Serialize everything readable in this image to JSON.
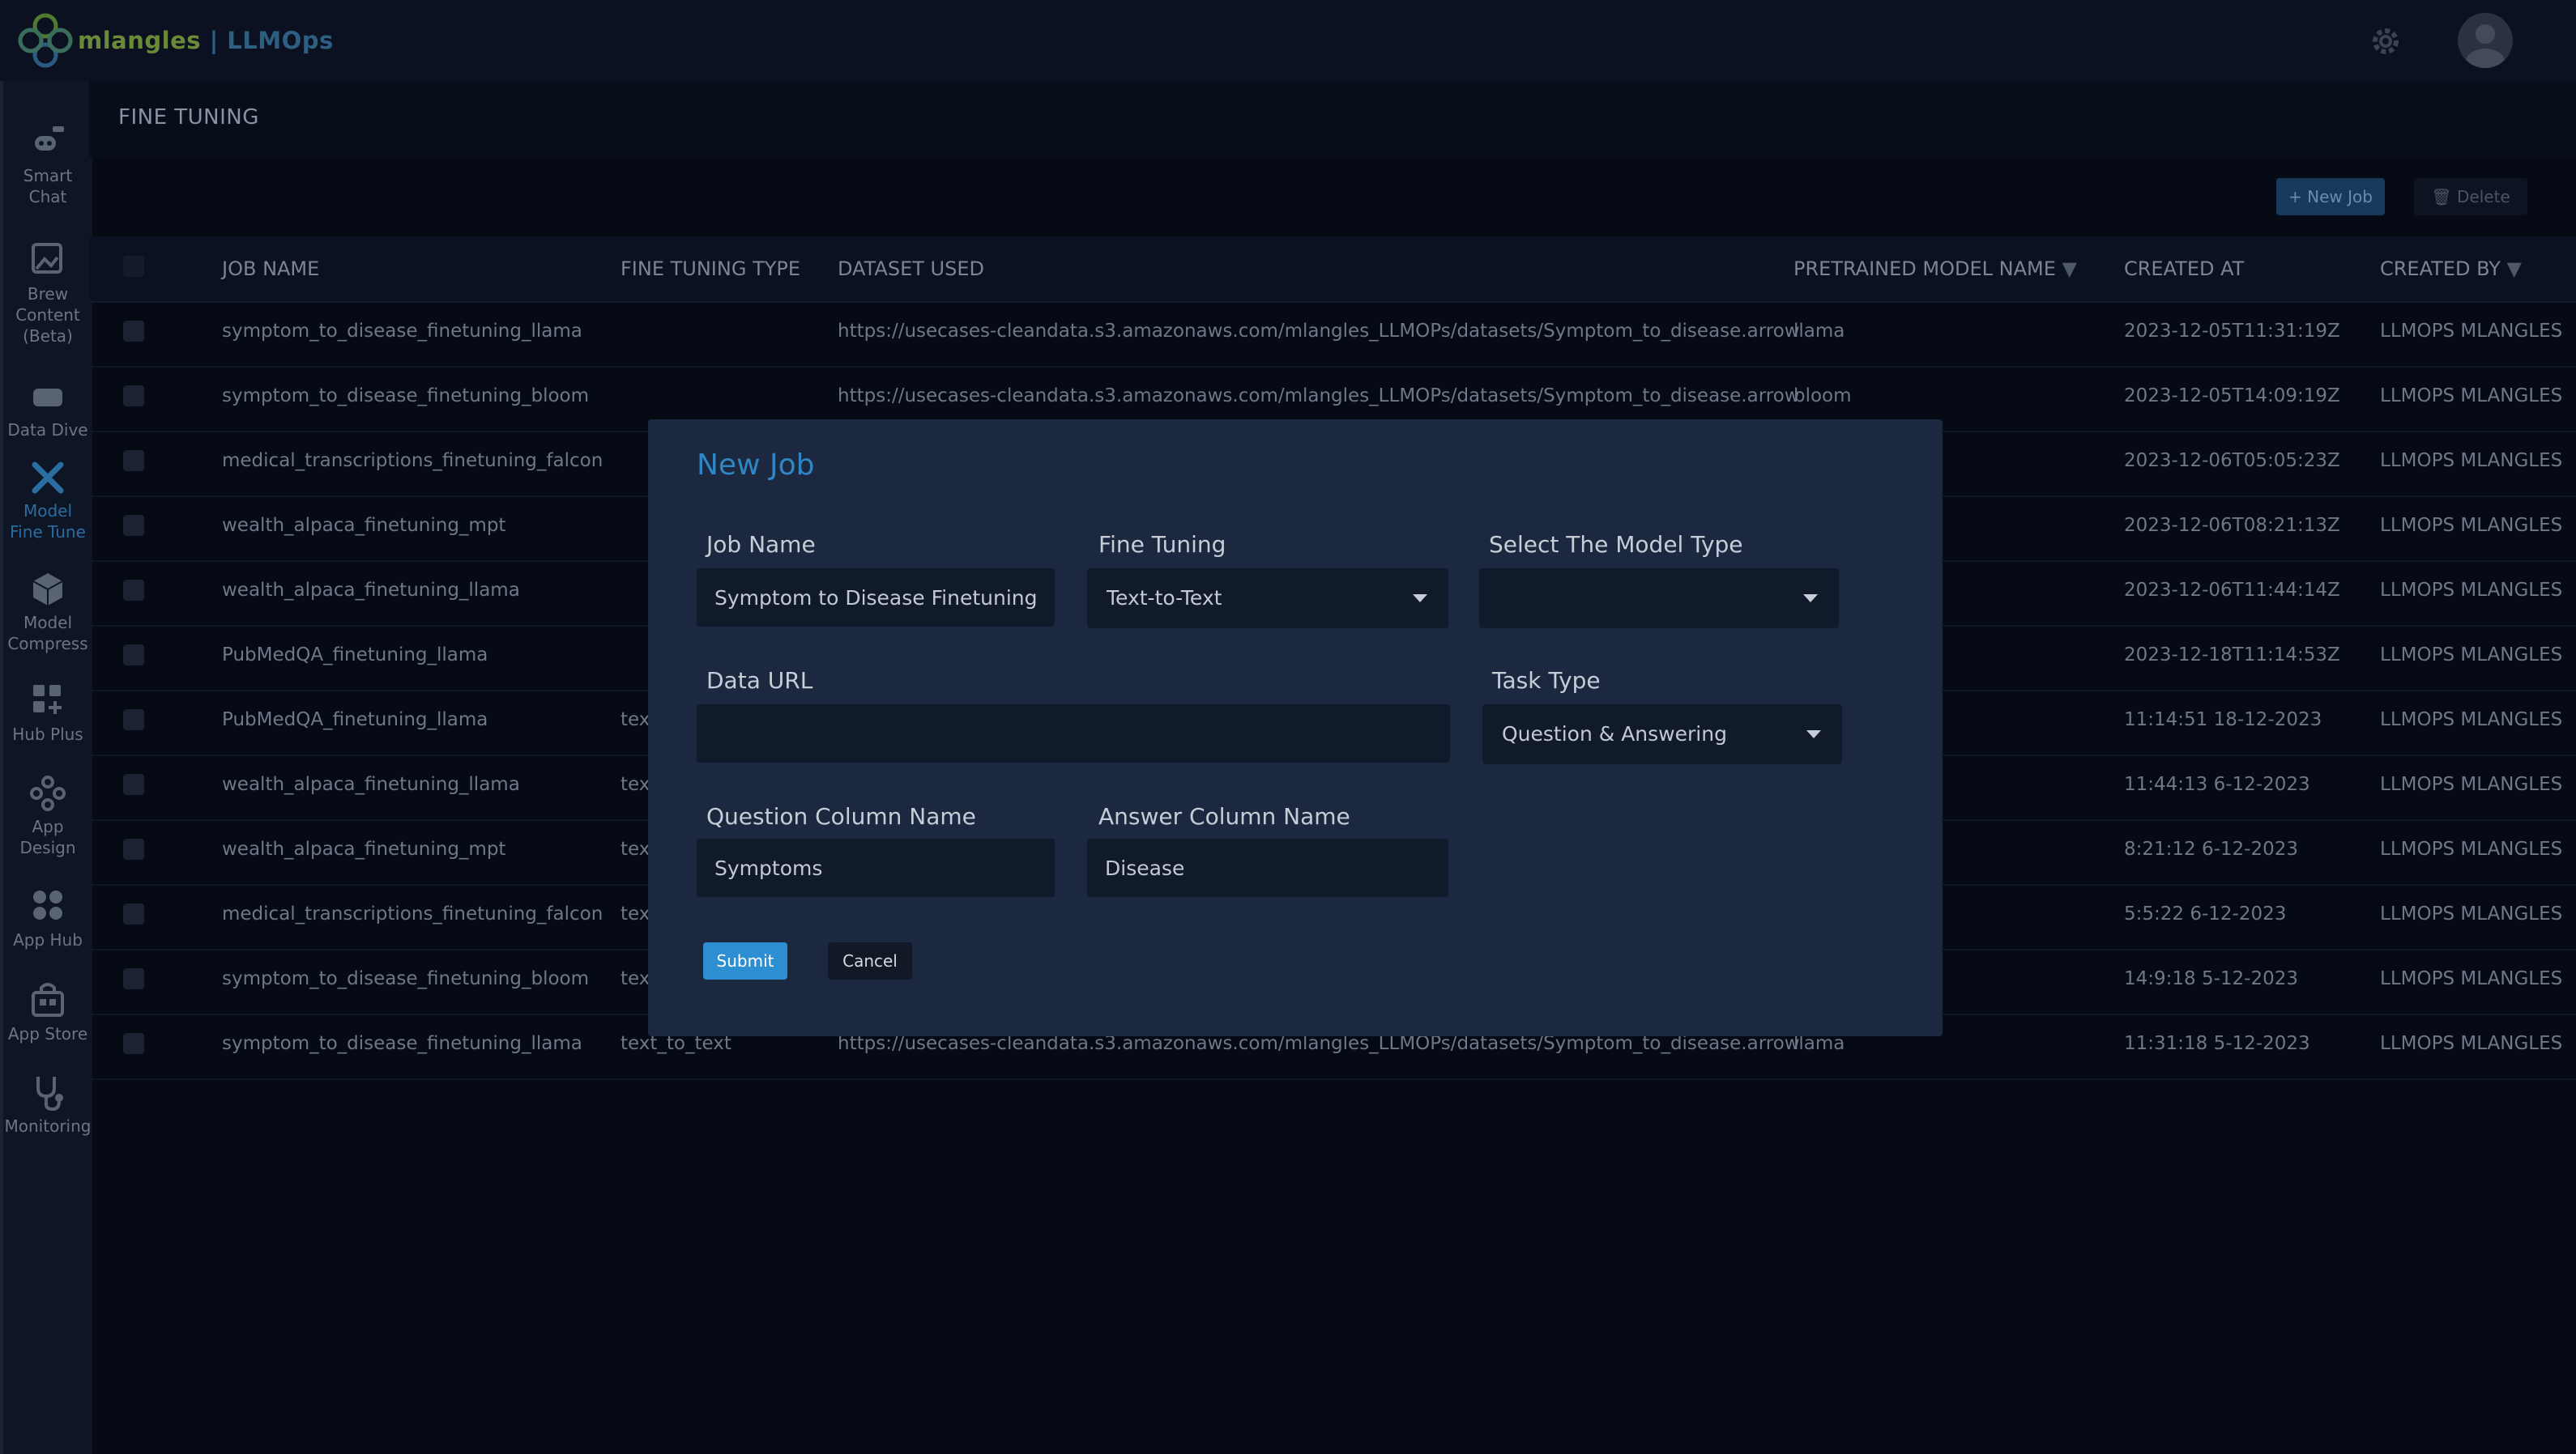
{
  "app": {
    "logo_part1": "mlangles",
    "logo_part2": " | LLMOps"
  },
  "header": {
    "settings_icon": "gear-icon",
    "avatar_icon": "user-avatar-icon"
  },
  "sidebar": {
    "items": [
      {
        "label_lines": [
          "Smart",
          "Chat"
        ],
        "icon": "robot-icon"
      },
      {
        "label_lines": [
          "Brew",
          "Content",
          "(Beta)"
        ],
        "icon": "image-ai-icon"
      },
      {
        "label_lines": [
          "Data Dive"
        ],
        "icon": "drive-icon"
      },
      {
        "label_lines": [
          "Model",
          "Fine Tune"
        ],
        "icon": "tools-icon",
        "active": true
      },
      {
        "label_lines": [
          "Model",
          "Compress"
        ],
        "icon": "cube-icon"
      },
      {
        "label_lines": [
          "Hub Plus"
        ],
        "icon": "grid-plus-icon"
      },
      {
        "label_lines": [
          "App",
          "Design"
        ],
        "icon": "design-icon"
      },
      {
        "label_lines": [
          "App Hub"
        ],
        "icon": "apps-icon"
      },
      {
        "label_lines": [
          "App Store"
        ],
        "icon": "store-icon"
      },
      {
        "label_lines": [
          "Monitoring"
        ],
        "icon": "stethoscope-icon"
      }
    ]
  },
  "page": {
    "title": "FINE TUNING"
  },
  "toolbar": {
    "new_job_label": "+ New Job",
    "delete_label": "Delete"
  },
  "table": {
    "columns": [
      "JOB NAME",
      "FINE TUNING TYPE",
      "DATASET USED",
      "PRETRAINED MODEL NAME",
      "CREATED AT",
      "CREATED BY"
    ],
    "rows": [
      {
        "job": "symptom_to_disease_finetuning_llama",
        "type": "",
        "dataset": "https://usecases-cleandata.s3.amazonaws.com/mlangles_LLMOPs/datasets/Symptom_to_disease.arrow",
        "model": "llama",
        "created_at": "2023-12-05T11:31:19Z",
        "created_by": "LLMOPS MLANGLES"
      },
      {
        "job": "symptom_to_disease_finetuning_bloom",
        "type": "",
        "dataset": "https://usecases-cleandata.s3.amazonaws.com/mlangles_LLMOPs/datasets/Symptom_to_disease.arrow",
        "model": "bloom",
        "created_at": "2023-12-05T14:09:19Z",
        "created_by": "LLMOPS MLANGLES"
      },
      {
        "job": "medical_transcriptions_finetuning_falcon",
        "type": "",
        "dataset": "",
        "model": "",
        "created_at": "2023-12-06T05:05:23Z",
        "created_by": "LLMOPS MLANGLES"
      },
      {
        "job": "wealth_alpaca_finetuning_mpt",
        "type": "",
        "dataset": "",
        "model": "",
        "created_at": "2023-12-06T08:21:13Z",
        "created_by": "LLMOPS MLANGLES"
      },
      {
        "job": "wealth_alpaca_finetuning_llama",
        "type": "",
        "dataset": "",
        "model": "",
        "created_at": "2023-12-06T11:44:14Z",
        "created_by": "LLMOPS MLANGLES"
      },
      {
        "job": "PubMedQA_finetuning_llama",
        "type": "",
        "dataset": "",
        "model": "",
        "created_at": "2023-12-18T11:14:53Z",
        "created_by": "LLMOPS MLANGLES"
      },
      {
        "job": "PubMedQA_finetuning_llama",
        "type": "tex",
        "dataset": "",
        "model": "",
        "created_at": "11:14:51 18-12-2023",
        "created_by": "LLMOPS MLANGLES"
      },
      {
        "job": "wealth_alpaca_finetuning_llama",
        "type": "tex",
        "dataset": "",
        "model": "",
        "created_at": "11:44:13 6-12-2023",
        "created_by": "LLMOPS MLANGLES"
      },
      {
        "job": "wealth_alpaca_finetuning_mpt",
        "type": "tex",
        "dataset": "",
        "model": "",
        "created_at": "8:21:12 6-12-2023",
        "created_by": "LLMOPS MLANGLES"
      },
      {
        "job": "medical_transcriptions_finetuning_falcon",
        "type": "tex",
        "dataset": "",
        "model": "",
        "created_at": "5:5:22 6-12-2023",
        "created_by": "LLMOPS MLANGLES"
      },
      {
        "job": "symptom_to_disease_finetuning_bloom",
        "type": "tex",
        "dataset": "",
        "model": "",
        "created_at": "14:9:18 5-12-2023",
        "created_by": "LLMOPS MLANGLES"
      },
      {
        "job": "symptom_to_disease_finetuning_llama",
        "type": "text_to_text",
        "dataset": "https://usecases-cleandata.s3.amazonaws.com/mlangles_LLMOPs/datasets/Symptom_to_disease.arrow",
        "model": "llama",
        "created_at": "11:31:18 5-12-2023",
        "created_by": "LLMOPS MLANGLES"
      }
    ]
  },
  "modal": {
    "title": "New Job",
    "job_name_label": "Job Name",
    "job_name_value": "Symptom to Disease Finetuning Llama",
    "fine_tuning_label": "Fine Tuning",
    "fine_tuning_value": "Text-to-Text",
    "model_type_label": "Select The Model Type",
    "model_type_value": "",
    "data_url_label": "Data URL",
    "data_url_value": "",
    "task_type_label": "Task Type",
    "task_type_value": "Question & Answering",
    "question_col_label": "Question Column Name",
    "question_col_value": "Symptoms",
    "answer_col_label": "Answer Column Name",
    "answer_col_value": "Disease",
    "submit_label": "Submit",
    "cancel_label": "Cancel"
  }
}
